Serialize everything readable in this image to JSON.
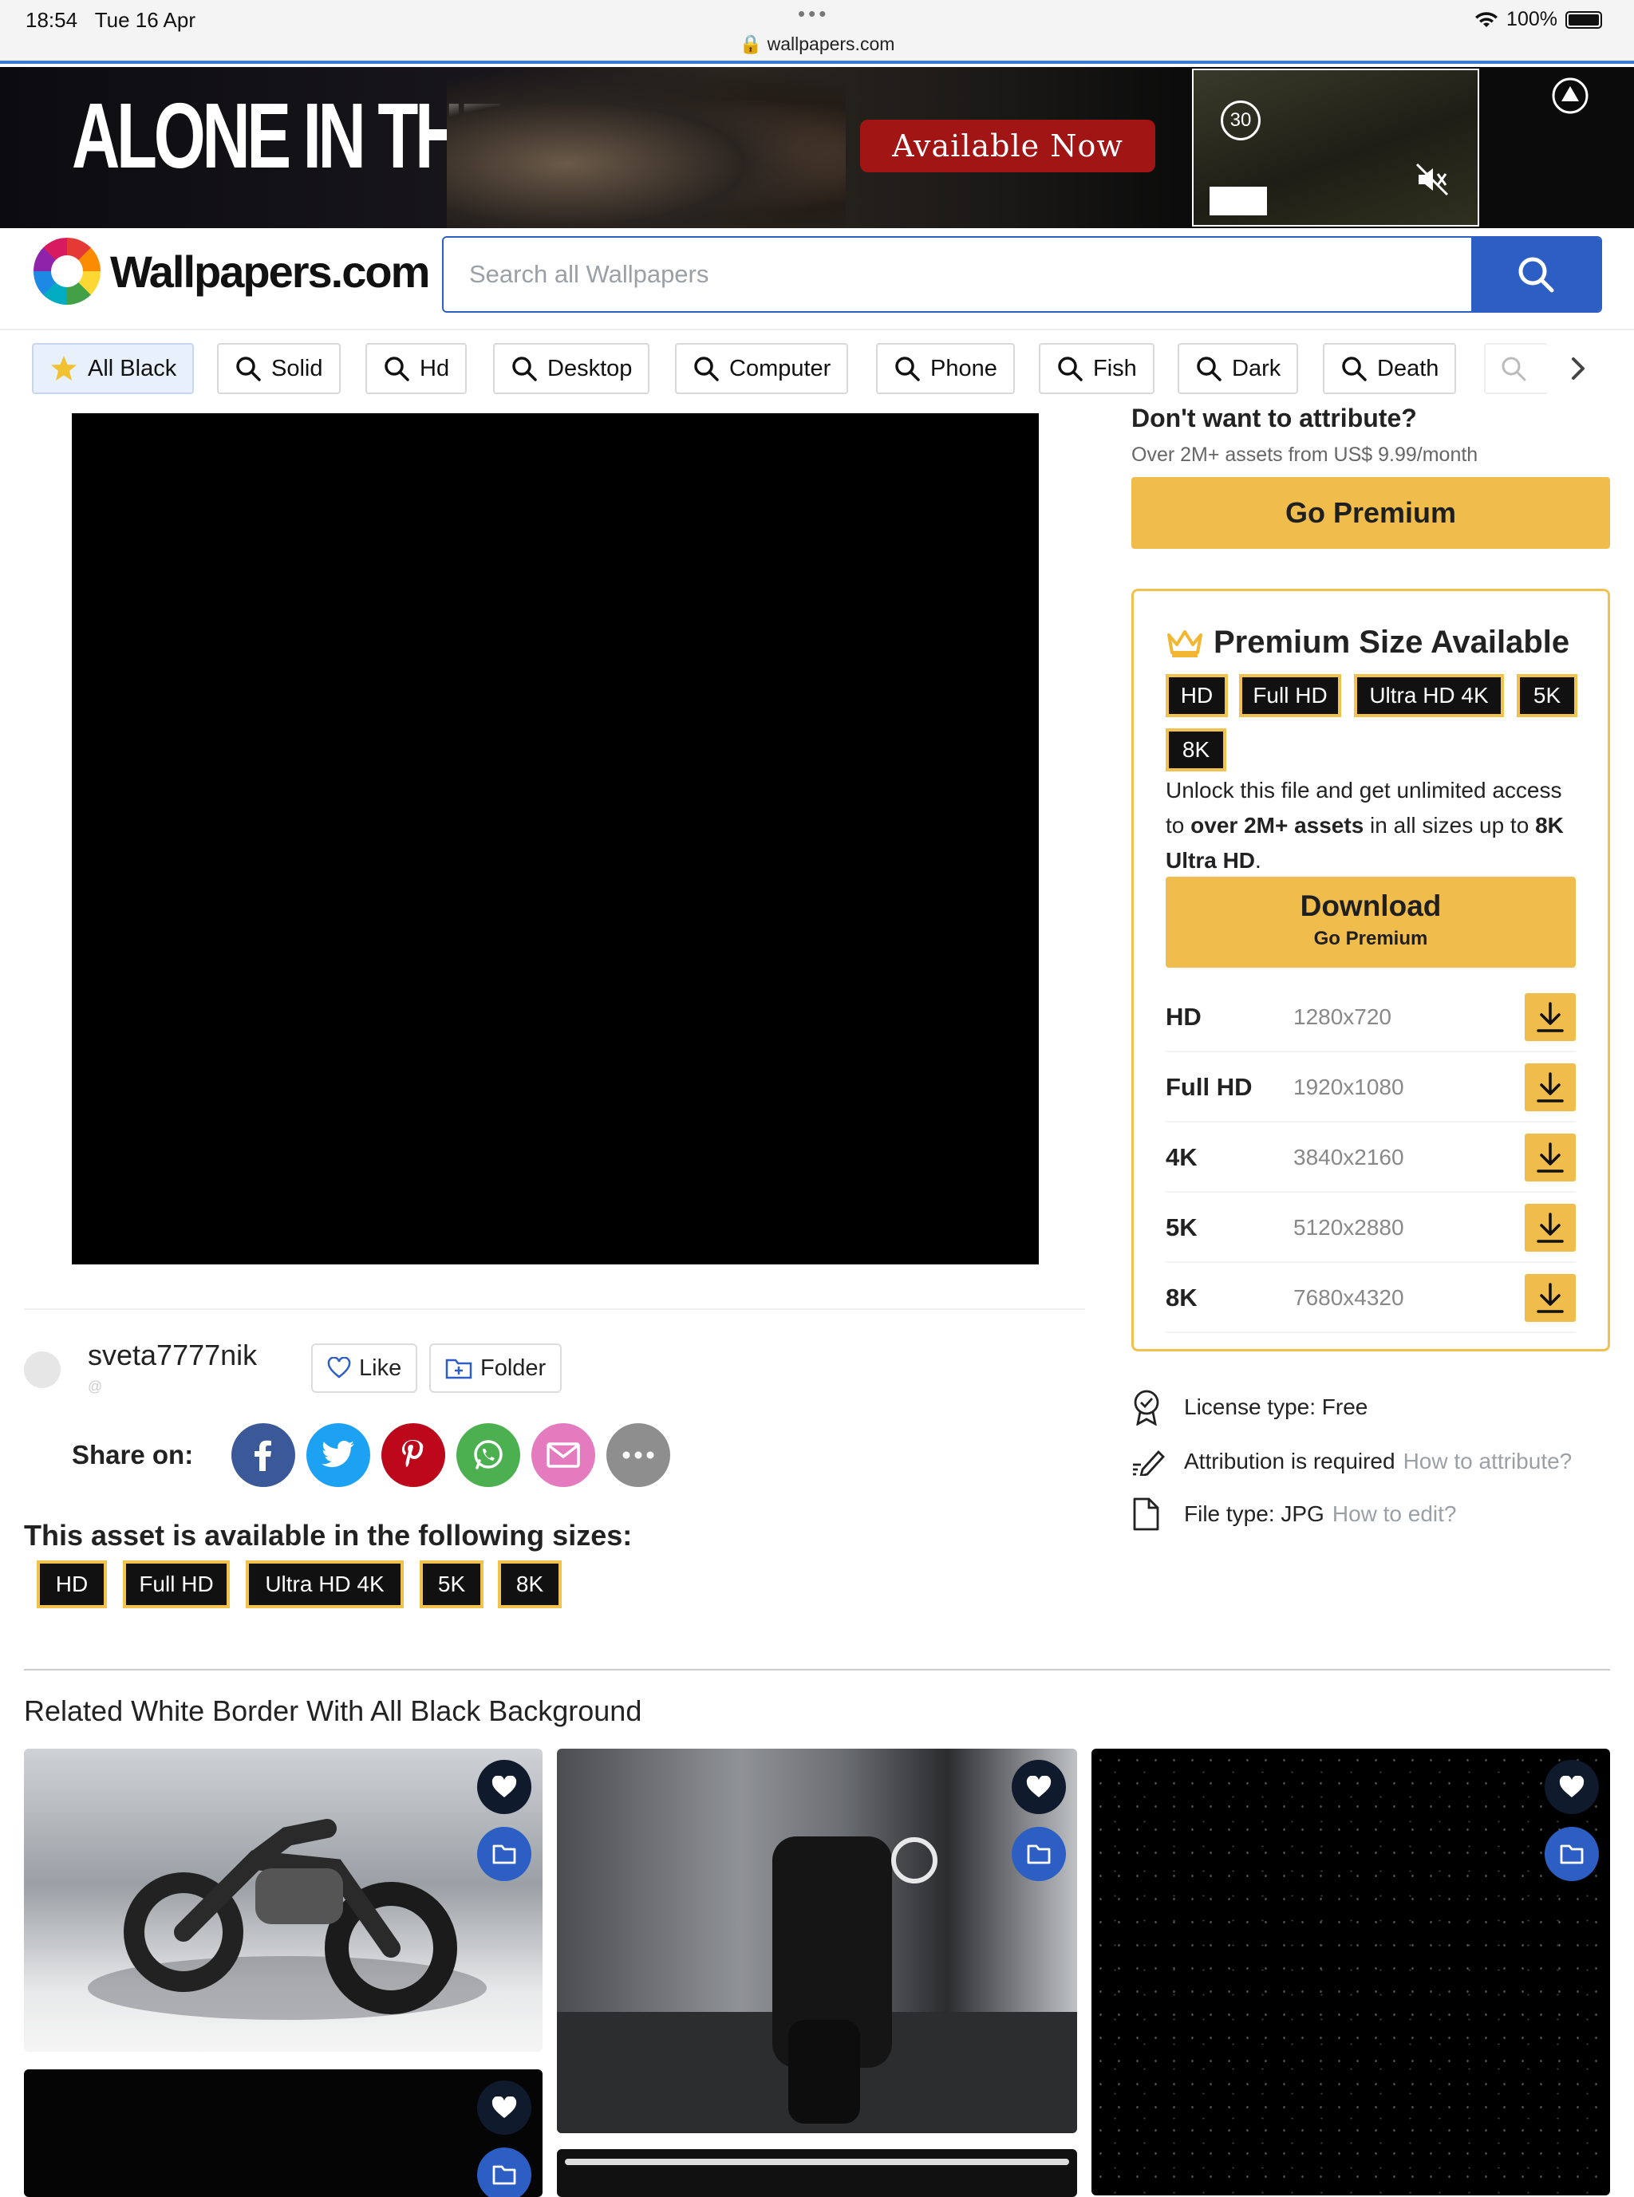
{
  "status_bar": {
    "time": "18:54",
    "date": "Tue 16 Apr",
    "url": "wallpapers.com",
    "battery": "100%"
  },
  "ad": {
    "game_logo": "ALONE IN THE DARK",
    "cta": "Available Now",
    "countdown": "30"
  },
  "brand": {
    "name": "Wallpapers.com"
  },
  "search": {
    "placeholder": "Search all Wallpapers"
  },
  "chips": [
    {
      "label": "All Black",
      "icon": "star-icon",
      "active": true
    },
    {
      "label": "Solid",
      "icon": "search-icon"
    },
    {
      "label": "Hd",
      "icon": "search-icon"
    },
    {
      "label": "Desktop",
      "icon": "search-icon"
    },
    {
      "label": "Computer",
      "icon": "search-icon"
    },
    {
      "label": "Phone",
      "icon": "search-icon"
    },
    {
      "label": "Fish",
      "icon": "search-icon"
    },
    {
      "label": "Dark",
      "icon": "search-icon"
    },
    {
      "label": "Death",
      "icon": "search-icon"
    }
  ],
  "user": {
    "name": "sveta7777nik",
    "handle": "@",
    "like_label": "Like",
    "folder_label": "Folder"
  },
  "share": {
    "label": "Share on:",
    "networks": [
      "facebook",
      "twitter",
      "pinterest",
      "whatsapp",
      "email",
      "more"
    ]
  },
  "sizes": {
    "title": "This asset is available in the following sizes:",
    "tags": [
      "HD",
      "Full HD",
      "Ultra HD 4K",
      "5K",
      "8K"
    ]
  },
  "premium": {
    "dont_attribute": "Don't want to attribute?",
    "assets_note": "Over 2M+ assets from US$ 9.99/month",
    "go_premium": "Go Premium",
    "box_title": "Premium Size Available",
    "tags": [
      "HD",
      "Full HD",
      "Ultra HD 4K",
      "5K",
      "8K"
    ],
    "unlock_pre": "Unlock this file and get unlimited access to ",
    "unlock_bold1": "over 2M+ assets",
    "unlock_mid": " in all sizes up to ",
    "unlock_bold2": "8K Ultra HD",
    "unlock_end": ".",
    "download": "Download",
    "download_sub": "Go Premium",
    "rows": [
      {
        "name": "HD",
        "res": "1280x720"
      },
      {
        "name": "Full HD",
        "res": "1920x1080"
      },
      {
        "name": "4K",
        "res": "3840x2160"
      },
      {
        "name": "5K",
        "res": "5120x2880"
      },
      {
        "name": "8K",
        "res": "7680x4320"
      }
    ]
  },
  "info": {
    "license": "License type: Free",
    "attribution": "Attribution is required",
    "attribution_link": "How to attribute?",
    "filetype": "File type: JPG",
    "filetype_link": "How to edit?"
  },
  "related": {
    "title": "Related White Border With All Black Background"
  },
  "colors": {
    "accent_blue": "#2c5ec4",
    "premium_gold": "#f0bd4c",
    "tag_border": "#f2c24f"
  }
}
